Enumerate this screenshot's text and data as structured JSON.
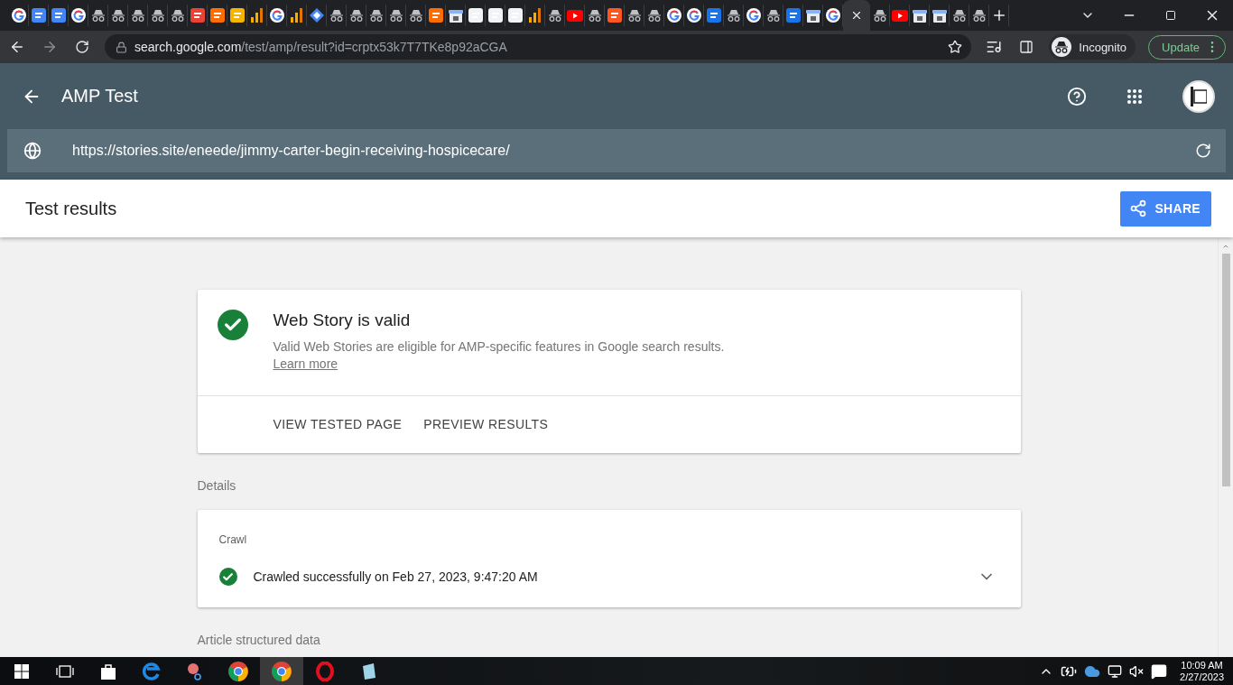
{
  "browser": {
    "url_host": "search.google.com",
    "url_path": "/test/amp/result?id=crptx53k7T7TKe8p92aCGA",
    "profile": "Incognito",
    "update_button": "Update"
  },
  "app_bar": {
    "title": "AMP Test"
  },
  "url_field": {
    "value": "https://stories.site/eneede/jimmy-carter-begin-receiving-hospicecare/"
  },
  "results_bar": {
    "title": "Test results",
    "share_button": "SHARE"
  },
  "summary": {
    "title": "Web Story is valid",
    "description": "Valid Web Stories are eligible for AMP-specific features in Google search results.",
    "link": "Learn more",
    "actions": [
      "VIEW TESTED PAGE",
      "PREVIEW RESULTS"
    ]
  },
  "sections": [
    {
      "heading": "Details",
      "card": {
        "label": "Crawl",
        "status": "Crawled successfully on Feb 27, 2023, 9:47:20 AM",
        "expanded": false
      }
    },
    {
      "heading": "Article structured data"
    }
  ],
  "taskbar": {
    "time": "10:09 AM",
    "date": "2/27/2023"
  }
}
